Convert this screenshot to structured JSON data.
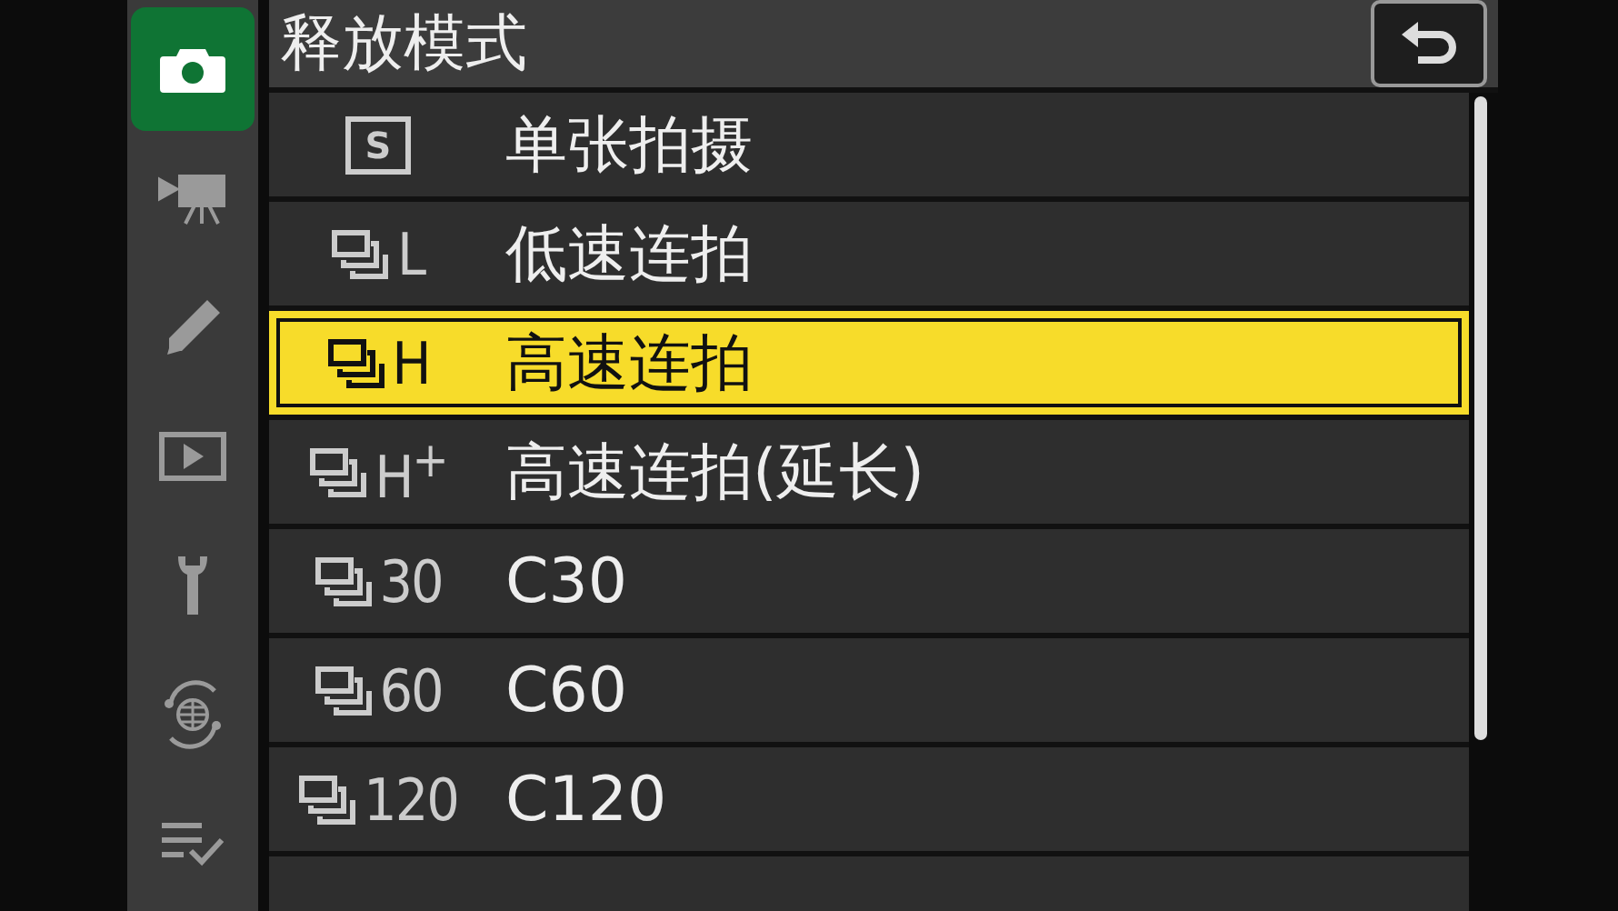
{
  "sidebar": {
    "items": [
      {
        "kind": "camera",
        "selected": true
      },
      {
        "kind": "movie",
        "selected": false
      },
      {
        "kind": "pencil",
        "selected": false
      },
      {
        "kind": "playback",
        "selected": false
      },
      {
        "kind": "wrench",
        "selected": false
      },
      {
        "kind": "network",
        "selected": false
      },
      {
        "kind": "mymenu",
        "selected": false
      }
    ]
  },
  "title": "释放模式",
  "rows": [
    {
      "kind": "single",
      "icon_label": "S",
      "label": "单张拍摄",
      "selected": false
    },
    {
      "kind": "continuous",
      "icon_label": "L",
      "label": "低速连拍",
      "selected": false
    },
    {
      "kind": "continuous",
      "icon_label": "H",
      "label": "高速连拍",
      "selected": true
    },
    {
      "kind": "continuous",
      "icon_label": "H$^{+}$",
      "label": "高速连拍(延长)",
      "selected": false
    },
    {
      "kind": "continuous",
      "icon_label": "30",
      "label": "C30",
      "selected": false
    },
    {
      "kind": "continuous",
      "icon_label": "60",
      "label": "C60",
      "selected": false
    },
    {
      "kind": "continuous",
      "icon_label": "120",
      "label": "C120",
      "selected": false
    }
  ]
}
